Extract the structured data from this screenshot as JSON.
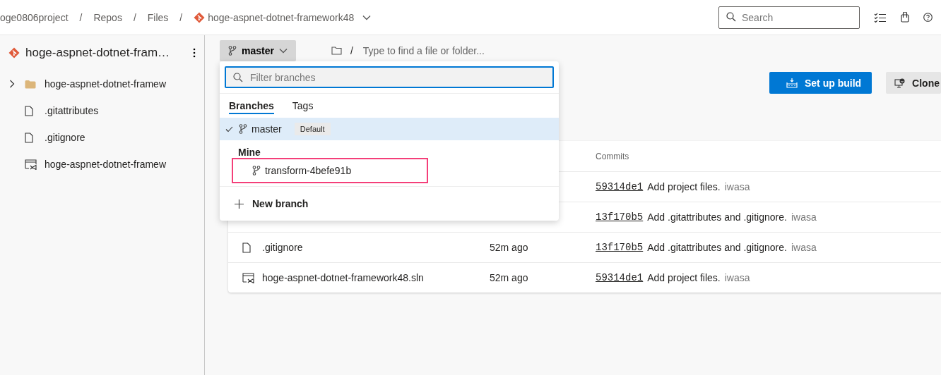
{
  "breadcrumb": [
    {
      "label": "oge0806project",
      "kind": "plain"
    },
    {
      "label": "Repos",
      "kind": "plain",
      "separator": "/"
    },
    {
      "label": "Files",
      "kind": "plain",
      "separator": "/"
    },
    {
      "label": "hoge-aspnet-dotnet-framework48",
      "kind": "repo",
      "separator": "/"
    }
  ],
  "search": {
    "placeholder": "Search"
  },
  "sidebar": {
    "repo_name": "hoge-aspnet-dotnet-fram…",
    "items": [
      {
        "name": "hoge-aspnet-dotnet-framew",
        "kind": "folder",
        "expanded": false
      },
      {
        "name": ".gitattributes",
        "kind": "file"
      },
      {
        "name": ".gitignore",
        "kind": "file"
      },
      {
        "name": "hoge-aspnet-dotnet-framew",
        "kind": "solution"
      }
    ]
  },
  "branch_button": {
    "label": "master"
  },
  "path_field": {
    "separator": "/",
    "placeholder": "Type to find a file or folder..."
  },
  "actions": [
    {
      "label": "Set up build",
      "kind": "primary"
    },
    {
      "label": "Clone",
      "kind": "secondary"
    }
  ],
  "branch_menu": {
    "filter": {
      "placeholder": "Filter branches"
    },
    "tabs": [
      {
        "label": "Branches",
        "selected": true
      },
      {
        "label": "Tags",
        "selected": false
      }
    ],
    "branches": [
      {
        "name": "master",
        "selected": true,
        "badge": "Default",
        "highlighted": false
      }
    ],
    "section": "Mine",
    "mine": [
      {
        "name": "transform-4befe91b",
        "selected": false,
        "highlighted": true
      }
    ],
    "new_branch": "New branch"
  },
  "table": {
    "commits_header": "Commits",
    "rows": [
      {
        "commit": "59314de1",
        "message": "Add project files.",
        "author": "iwasa"
      },
      {
        "commit": "13f170b5",
        "message": "Add .gitattributes and .gitignore.",
        "author": "iwasa"
      },
      {
        "name": ".gitignore",
        "kind": "file",
        "age": "52m ago",
        "commit": "13f170b5",
        "message": "Add .gitattributes and .gitignore.",
        "author": "iwasa"
      },
      {
        "name": "hoge-aspnet-dotnet-framework48.sln",
        "kind": "solution",
        "age": "52m ago",
        "commit": "59314de1",
        "message": "Add project files.",
        "author": "iwasa"
      }
    ]
  }
}
